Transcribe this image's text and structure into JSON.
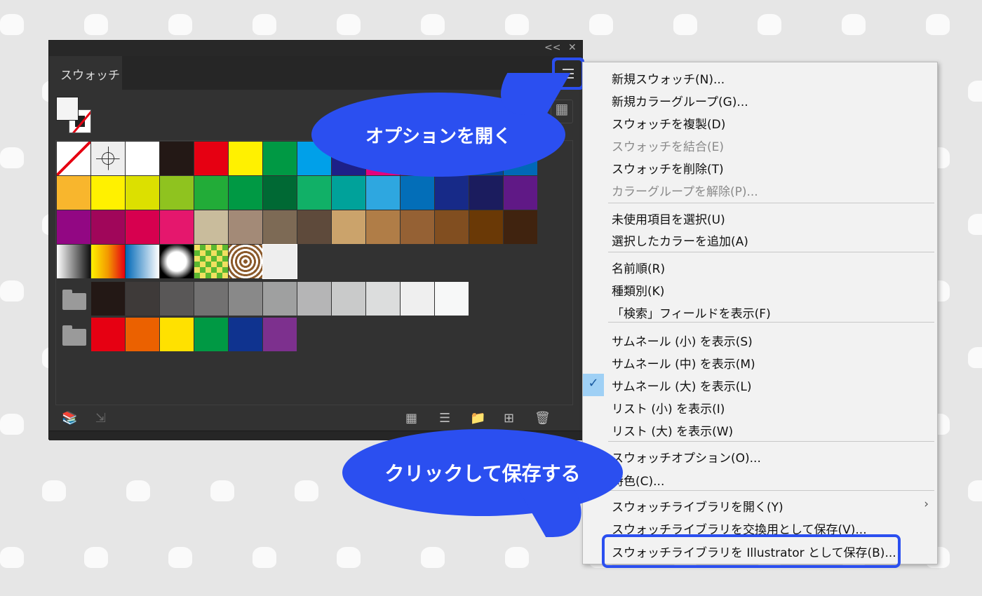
{
  "panel": {
    "tab": "スウォッチ",
    "collapse_icon": "<<",
    "close_icon": "✕"
  },
  "swatch_rows": [
    [
      "none",
      "registration",
      "#ffffff",
      "#231815",
      "#e60012",
      "#fff100",
      "#009944",
      "#00a0e9",
      "#1d2088",
      "#e4007f",
      "#920783",
      "#601986",
      "#00479d",
      "#0068b7"
    ],
    [
      "#f8b62d",
      "#fff100",
      "#dce000",
      "#8fc31f",
      "#22ac38",
      "#009944",
      "#006934",
      "#11b067",
      "#00a29a",
      "#2ea7e0",
      "#036eb8",
      "#172a88",
      "#1b1c5e",
      "#601986"
    ],
    [
      "#920783",
      "#a0065a",
      "#d7004f",
      "#e5176d",
      "#c9bc9c",
      "#a38a77",
      "#7d6a55",
      "#5e4a3b",
      "#cba36b",
      "#b07d47",
      "#956134",
      "#814e20",
      "#6a3906",
      "#40230f"
    ],
    [
      "gradient-white-black",
      "gradient-yellow-red",
      "gradient-blue",
      "radial-fade",
      "pattern-leaves",
      "pattern-swirl",
      "pattern-cats"
    ]
  ],
  "groups": [
    [
      "#231815",
      "#3e3a39",
      "#595757",
      "#727171",
      "#898989",
      "#9fa0a0",
      "#b5b5b6",
      "#c9caca",
      "#dcdddd",
      "#efefef",
      "#f7f8f8"
    ],
    [
      "#e60012",
      "#eb6100",
      "#ffe100",
      "#009944",
      "#0f338f",
      "#7d308e"
    ]
  ],
  "menu": {
    "items": [
      {
        "label": "新規スウォッチ(N)...",
        "enabled": true
      },
      {
        "label": "新規カラーグループ(G)...",
        "enabled": true
      },
      {
        "label": "スウォッチを複製(D)",
        "enabled": true
      },
      {
        "label": "スウォッチを結合(E)",
        "enabled": false
      },
      {
        "label": "スウォッチを削除(T)",
        "enabled": true
      },
      {
        "label": "カラーグループを解除(P)...",
        "enabled": false
      },
      {
        "label": "未使用項目を選択(U)",
        "enabled": true
      },
      {
        "label": "選択したカラーを追加(A)",
        "enabled": true
      },
      {
        "label": "名前順(R)",
        "enabled": true
      },
      {
        "label": "種類別(K)",
        "enabled": true
      },
      {
        "label": "「検索」フィールドを表示(F)",
        "enabled": true
      },
      {
        "label": "サムネール (小) を表示(S)",
        "enabled": true
      },
      {
        "label": "サムネール (中) を表示(M)",
        "enabled": true
      },
      {
        "label": "サムネール (大) を表示(L)",
        "enabled": true,
        "checked": true
      },
      {
        "label": "リスト (小) を表示(I)",
        "enabled": true
      },
      {
        "label": "リスト (大) を表示(W)",
        "enabled": true
      },
      {
        "label": "スウォッチオプション(O)...",
        "enabled": true
      },
      {
        "label": "特色(C)...",
        "enabled": true
      },
      {
        "label": "スウォッチライブラリを開く(Y)",
        "enabled": true,
        "submenu": true
      },
      {
        "label": "スウォッチライブラリを交換用として保存(V)...",
        "enabled": true
      },
      {
        "label": "スウォッチライブラリを Illustrator として保存(B)...",
        "enabled": true
      }
    ],
    "check_icon": "✓",
    "submenu_icon": "›"
  },
  "callouts": {
    "open_options": "オプションを開く",
    "click_save": "クリックして保存する"
  },
  "accent": "#2b4ff0"
}
